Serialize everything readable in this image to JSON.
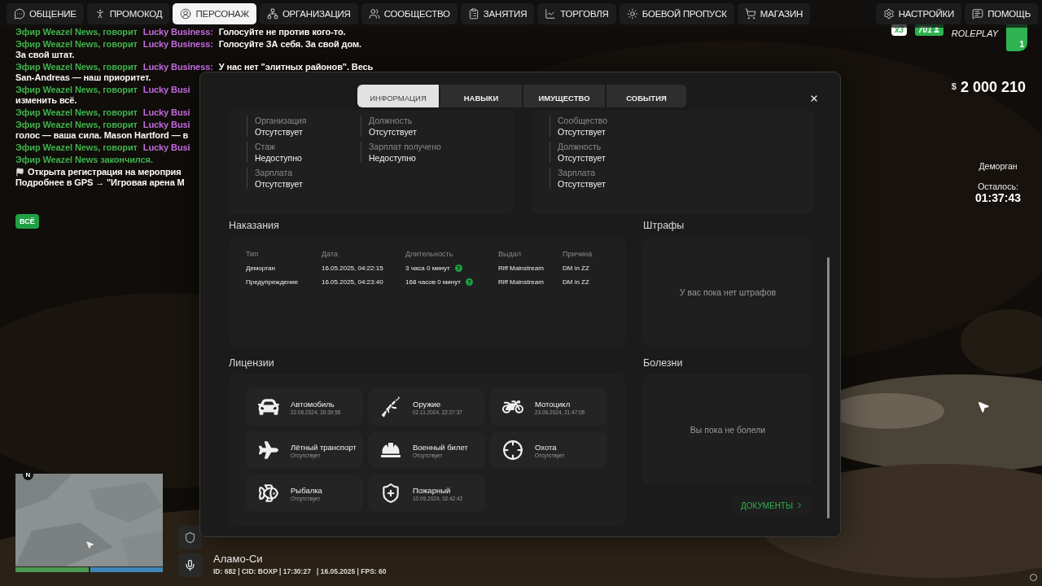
{
  "top_menu": [
    {
      "label": "ОБЩЕНИЕ",
      "kind": "chat",
      "selected": false
    },
    {
      "label": "ПРОМОКОД",
      "kind": "promo",
      "selected": false
    },
    {
      "label": "ПЕРСОНАЖ",
      "kind": "character",
      "selected": true
    },
    {
      "label": "ОРГАНИЗАЦИЯ",
      "kind": "organization",
      "selected": false
    },
    {
      "label": "СООБЩЕСТВО",
      "kind": "community",
      "selected": false
    },
    {
      "label": "ЗАНЯТИЯ",
      "kind": "activities",
      "selected": false
    },
    {
      "label": "ТОРГОВЛЯ",
      "kind": "trade",
      "selected": false
    },
    {
      "label": "БОЕВОЙ ПРОПУСК",
      "kind": "pass",
      "selected": false
    },
    {
      "label": "МАГАЗИН",
      "kind": "shop",
      "selected": false
    }
  ],
  "top_menu_right": [
    {
      "label": "НАСТРОЙКИ",
      "kind": "settings",
      "selected": false
    },
    {
      "label": "ПОМОЩЬ",
      "kind": "help",
      "selected": false
    }
  ],
  "chat": [
    {
      "lines": [
        [
          {
            "kind": "channel",
            "text": "Эфир Weazel News, говорит "
          },
          {
            "kind": "speaker",
            "text": "Lucky Business:"
          },
          {
            "kind": "message",
            "text": " Голосуйте не против кого-то."
          }
        ]
      ]
    },
    {
      "lines": [
        [
          {
            "kind": "channel",
            "text": "Эфир Weazel News, говорит "
          },
          {
            "kind": "speaker",
            "text": "Lucky Business:"
          },
          {
            "kind": "message",
            "text": " Голосуйте ЗА себя. За свой дом."
          }
        ],
        [
          {
            "kind": "message",
            "text": "За свой штат."
          }
        ]
      ]
    },
    {
      "lines": [
        [
          {
            "kind": "channel",
            "text": "Эфир Weazel News, говорит "
          },
          {
            "kind": "speaker",
            "text": "Lucky Business:"
          },
          {
            "kind": "message",
            "text": " У нас нет \"элитных районов\". Весь"
          }
        ],
        [
          {
            "kind": "message",
            "text": "San-Andreas — наш приоритет."
          }
        ]
      ]
    },
    {
      "lines": [
        [
          {
            "kind": "channel",
            "text": "Эфир Weazel News, говорит "
          },
          {
            "kind": "speaker",
            "text": "Lucky Busi"
          }
        ],
        [
          {
            "kind": "message",
            "text": "изменить всё."
          }
        ]
      ]
    },
    {
      "lines": [
        [
          {
            "kind": "channel",
            "text": "Эфир Weazel News, говорит "
          },
          {
            "kind": "speaker",
            "text": "Lucky Busi"
          }
        ]
      ]
    },
    {
      "lines": [
        [
          {
            "kind": "channel",
            "text": "Эфир Weazel News, говорит "
          },
          {
            "kind": "speaker",
            "text": "Lucky Busi"
          }
        ],
        [
          {
            "kind": "message",
            "text": "голос — ваша сила. Mason Hartford — в"
          }
        ]
      ]
    },
    {
      "lines": [
        [
          {
            "kind": "channel",
            "text": "Эфир Weazel News, говорит "
          },
          {
            "kind": "speaker",
            "text": "Lucky Busi"
          }
        ]
      ]
    },
    {
      "lines": [
        [
          {
            "kind": "channel",
            "text": "Эфир Weazel News закончился."
          }
        ]
      ]
    },
    {
      "flag": true,
      "lines": [
        [
          {
            "kind": "message",
            "text": "Открыта регистрация на мероприя"
          }
        ],
        [
          {
            "kind": "message",
            "text": "Подробнее в GPS → \"Игровая арена M"
          }
        ]
      ]
    }
  ],
  "chat_filter": "ВСЁ",
  "modal": {
    "tabs": [
      {
        "label": "ИНФОРМАЦИЯ",
        "selected": true
      },
      {
        "label": "НАВЫКИ",
        "selected": false
      },
      {
        "label": "ИМУЩЕСТВО",
        "selected": false
      },
      {
        "label": "СОБЫТИЯ",
        "selected": false
      }
    ],
    "info_cards": [
      {
        "columns": [
          [
            {
              "label": "Организация",
              "value": "Отсутствует"
            },
            {
              "label": "Стаж",
              "value": "Недоступно"
            },
            {
              "label": "Зарплата",
              "value": "Отсутствует"
            }
          ],
          [
            {
              "label": "Должность",
              "value": "Отсутствует"
            },
            {
              "label": "Зарплат получено",
              "value": "Недоступно"
            }
          ]
        ]
      },
      {
        "columns": [
          [
            {
              "label": "Сообщество",
              "value": "Отсутствует"
            },
            {
              "label": "Должность",
              "value": "Отсутствует"
            },
            {
              "label": "Зарплата",
              "value": "Отсутствует"
            }
          ]
        ]
      }
    ],
    "punishments": {
      "title": "Наказания",
      "columns": [
        "Тип",
        "Дата",
        "Длительность",
        "Выдал",
        "Причина"
      ],
      "rows": [
        {
          "type": "Деморган",
          "date": "16.05.2025, 04:22:15",
          "duration": "3 часа 0 минут",
          "hint": "?",
          "issuer": "Riff Mainstream",
          "reason": "DM in ZZ"
        },
        {
          "type": "Предупреждение",
          "date": "16.05.2025, 04:23:40",
          "duration": "168 часов 0 минут",
          "hint": "?",
          "issuer": "Riff Mainstream",
          "reason": "DM in ZZ"
        }
      ]
    },
    "fines": {
      "title": "Штрафы",
      "empty": "У вас пока нет штрафов"
    },
    "licenses": {
      "title": "Лицензии",
      "items": [
        {
          "kind": "car",
          "name": "Автомобиль",
          "status": "22.06.2024, 20:39:56"
        },
        {
          "kind": "weapon",
          "name": "Оружие",
          "status": "02.11.2024, 22:27:37"
        },
        {
          "kind": "moto",
          "name": "Мотоцикл",
          "status": "23.06.2024, 21:47:05"
        },
        {
          "kind": "air",
          "name": "Лётный транспорт",
          "status": "Отсутствует"
        },
        {
          "kind": "military",
          "name": "Военный билет",
          "status": "Отсутствует"
        },
        {
          "kind": "hunting",
          "name": "Охота",
          "status": "Отсутствует"
        },
        {
          "kind": "fishing",
          "name": "Рыбалка",
          "status": "Отсутствует"
        },
        {
          "kind": "fire",
          "name": "Пожарный",
          "status": "10.09.2024, 02:42:42"
        }
      ]
    },
    "illnesses": {
      "title": "Болезни",
      "empty": "Вы пока не болели"
    },
    "documents_button": "ДОКУМЕНТЫ"
  },
  "hud": {
    "multiplier": "x3",
    "online": "701",
    "brand": "ROLEPLAY",
    "server": "1",
    "currency": "$",
    "money": "2 000 210",
    "jail": {
      "label": "Деморган",
      "remaining_label": "Осталось:",
      "time": "01:37:43"
    },
    "compass": "N",
    "health": {
      "level": 1
    },
    "armor": {
      "level": 1
    },
    "location": "Аламо-Си",
    "status_line": "ID: 682 | CID: BOXP | 17:30:27   | 16.05.2025 | FPS: 60"
  }
}
